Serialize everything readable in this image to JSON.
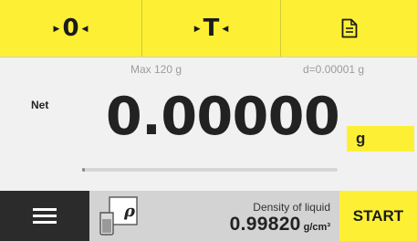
{
  "topbar": {
    "zero_label": "0",
    "tare_label": "T",
    "protocol_icon": "document-icon",
    "color": "#fdf034"
  },
  "info": {
    "max": "Max 120 g",
    "d": "d=0.00001 g"
  },
  "display": {
    "net_label": "Net",
    "value": "0.00000",
    "unit": "g"
  },
  "capacity_bar": {
    "fill_fraction": 0.01
  },
  "bottom": {
    "menu_icon": "hamburger-menu-icon",
    "app_icon": "density-icon",
    "app_icon_symbol": "ρ",
    "app_title": "Density of liquid",
    "app_value": "0.99820",
    "app_unit": "g/cm³",
    "start_label": "START"
  }
}
